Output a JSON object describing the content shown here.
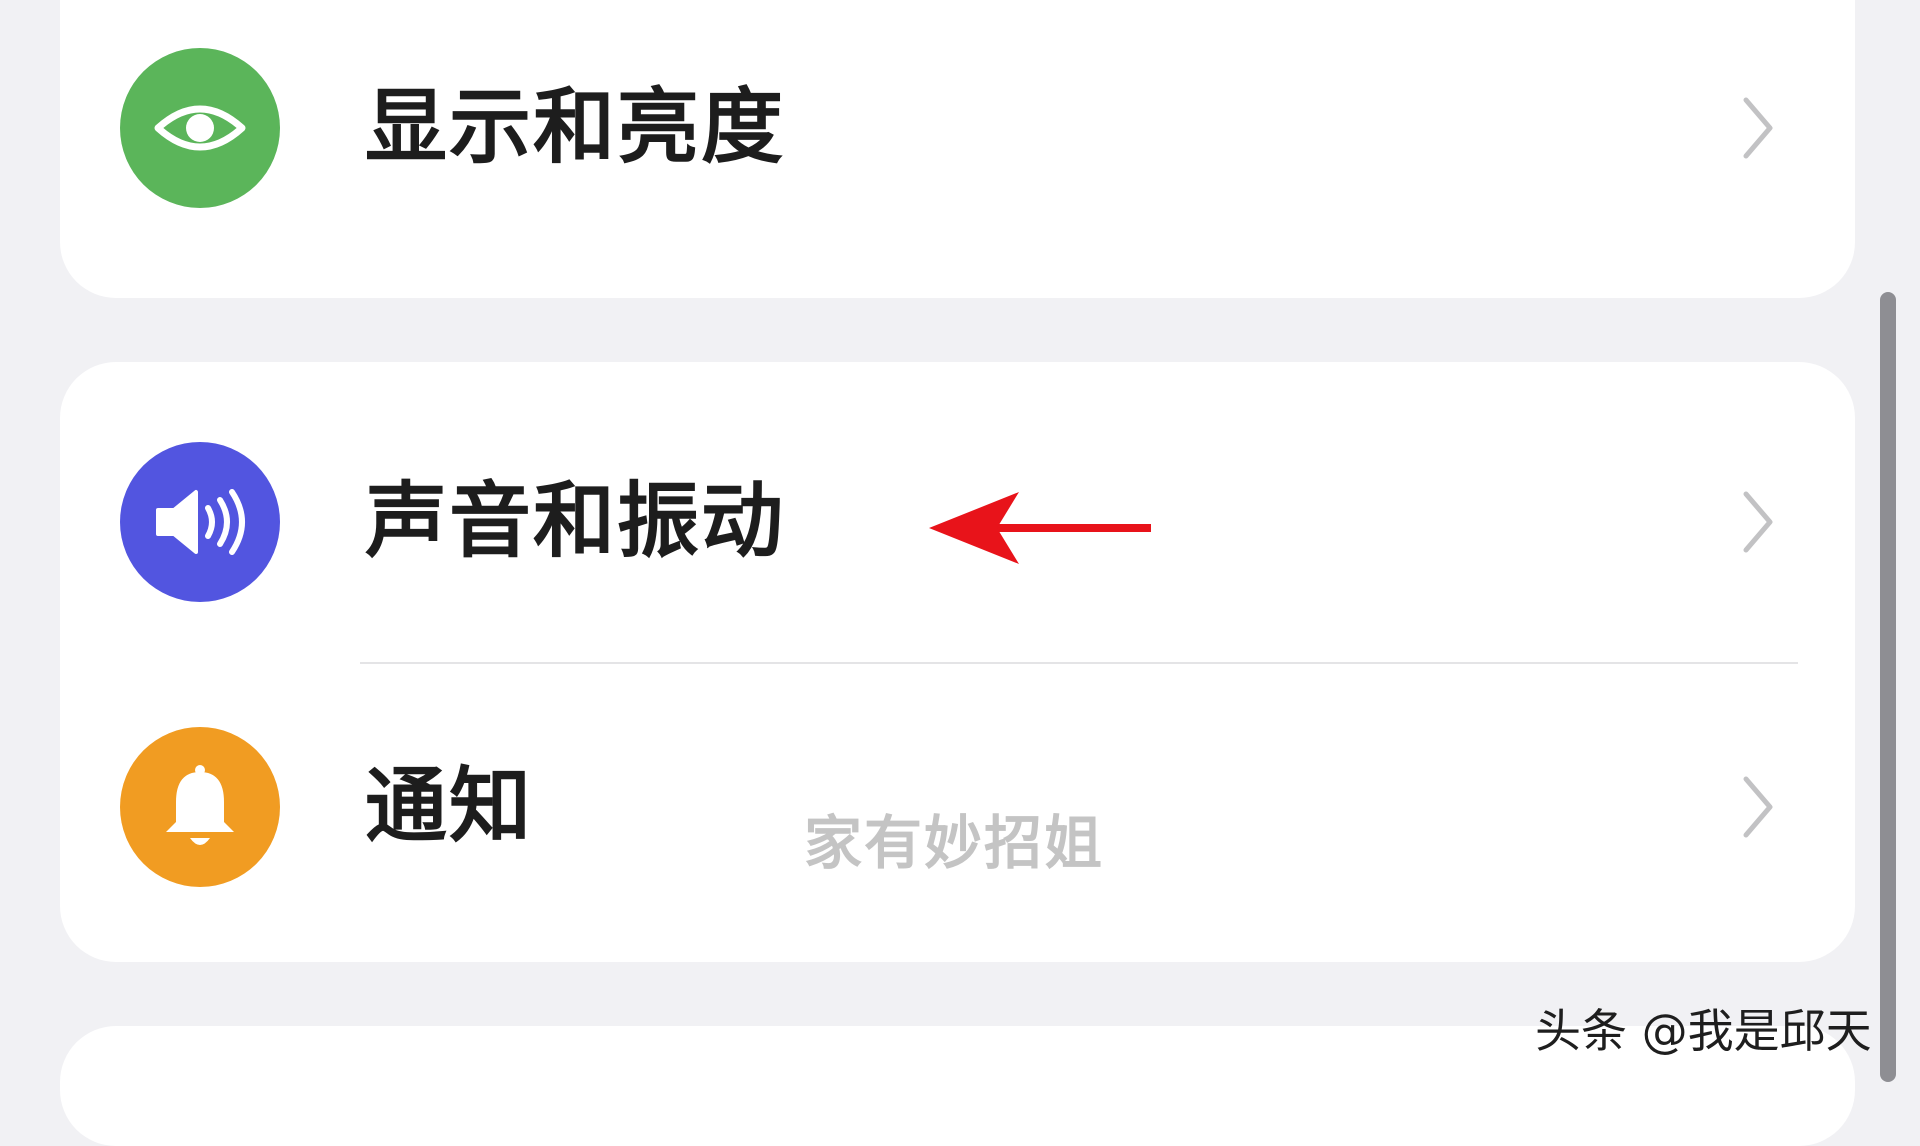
{
  "settings": {
    "display": {
      "label": "显示和亮度",
      "icon": "eye-icon",
      "color": "#5bb55a"
    },
    "sound": {
      "label": "声音和振动",
      "icon": "speaker-icon",
      "color": "#5255e0"
    },
    "notification": {
      "label": "通知",
      "icon": "bell-icon",
      "color": "#f19c22"
    }
  },
  "overlay": {
    "watermark": "家有妙招姐",
    "credit": "头条 @我是邱天",
    "arrow_color": "#e8131a"
  }
}
